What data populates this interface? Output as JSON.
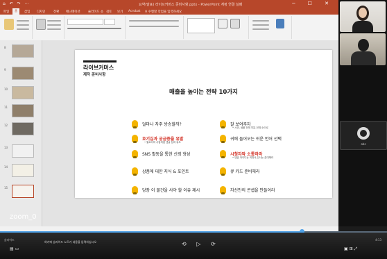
{
  "window": {
    "quick_access": "⌂ ↶ ↷ ⋯",
    "title": "요약(발표) 라이브커머스 준비사항.pptx - PowerPoint 계정 연결 실패",
    "controls": "─ ☐ ✕"
  },
  "ribbon": {
    "tabs": [
      "파일",
      "홈",
      "삽입",
      "디자인",
      "전환",
      "애니메이션",
      "슬라이드 쇼",
      "검토",
      "보기",
      "Acrobat",
      "♀ 수행할 작업을 입력하세요"
    ],
    "active_tab_index": 1
  },
  "thumbnails": [
    {
      "num": "8"
    },
    {
      "num": "9"
    },
    {
      "num": "10"
    },
    {
      "num": "11"
    },
    {
      "num": "12"
    },
    {
      "num": "13"
    },
    {
      "num": "14"
    },
    {
      "num": "15"
    }
  ],
  "slide": {
    "brand_line1": "라이브커머스",
    "brand_line2": "제작 준비사항",
    "title": "매출을 높이는 전략 10가지",
    "strategies_left": [
      {
        "text": "얼마나 자주 방송할까?",
        "sub": "",
        "red": false
      },
      {
        "text": "호기심과 궁금증을 유발",
        "sub": "• 필요이하 사람처럼 댓글 참여 유도",
        "red": true
      },
      {
        "text": "SNS 활동을 통한 신뢰 형성",
        "sub": "",
        "red": false
      },
      {
        "text": "상품에 대한 지식 & 포인트",
        "sub": "",
        "red": false
      },
      {
        "text": "당장 이 물건을 사야 할 이유 제시",
        "sub": "",
        "red": false
      }
    ],
    "strategies_right": [
      {
        "text": "잘 보여주자",
        "sub": "• 시연, 샘플 전체 부분-전체 순으로",
        "red": false
      },
      {
        "text": "귀에 들어오는 쉬운 언어 선택",
        "sub": "",
        "red": false
      },
      {
        "text": "시청자와 소통하라",
        "sub": "• 댓글 아이디는 외워서,인사는 존대해라",
        "red": true
      },
      {
        "text": "큐 카드 준비해라",
        "sub": "",
        "red": false
      },
      {
        "text": "자신만의 콘셉을 만들어라",
        "sub": "",
        "red": false
      }
    ]
  },
  "webcams": {
    "source_label": "obs"
  },
  "overlay": {
    "zoom_label": "zoom_0"
  },
  "player": {
    "progress": 0.78,
    "status_left": "슬라이드",
    "notes": "여기에 슬라이드 노트가 내용을 입력하십시오",
    "play_controls": "⟲ ▷ ⟳",
    "time_right": "4:13"
  },
  "colors": {
    "accent": "#b7472a",
    "bulb": "#f4b400",
    "highlight_text": "#d12b1f",
    "progress": "#4ea1e6"
  }
}
